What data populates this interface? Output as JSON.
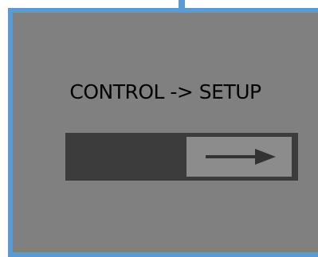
{
  "panel": {
    "title": "CONTROL -> SETUP",
    "accent_color": "#5b9bd5",
    "background_color": "#808080"
  },
  "slider": {
    "icon": "arrow-right-icon",
    "track_color": "#3c3c3c",
    "thumb_color": "#8c8c8c"
  }
}
